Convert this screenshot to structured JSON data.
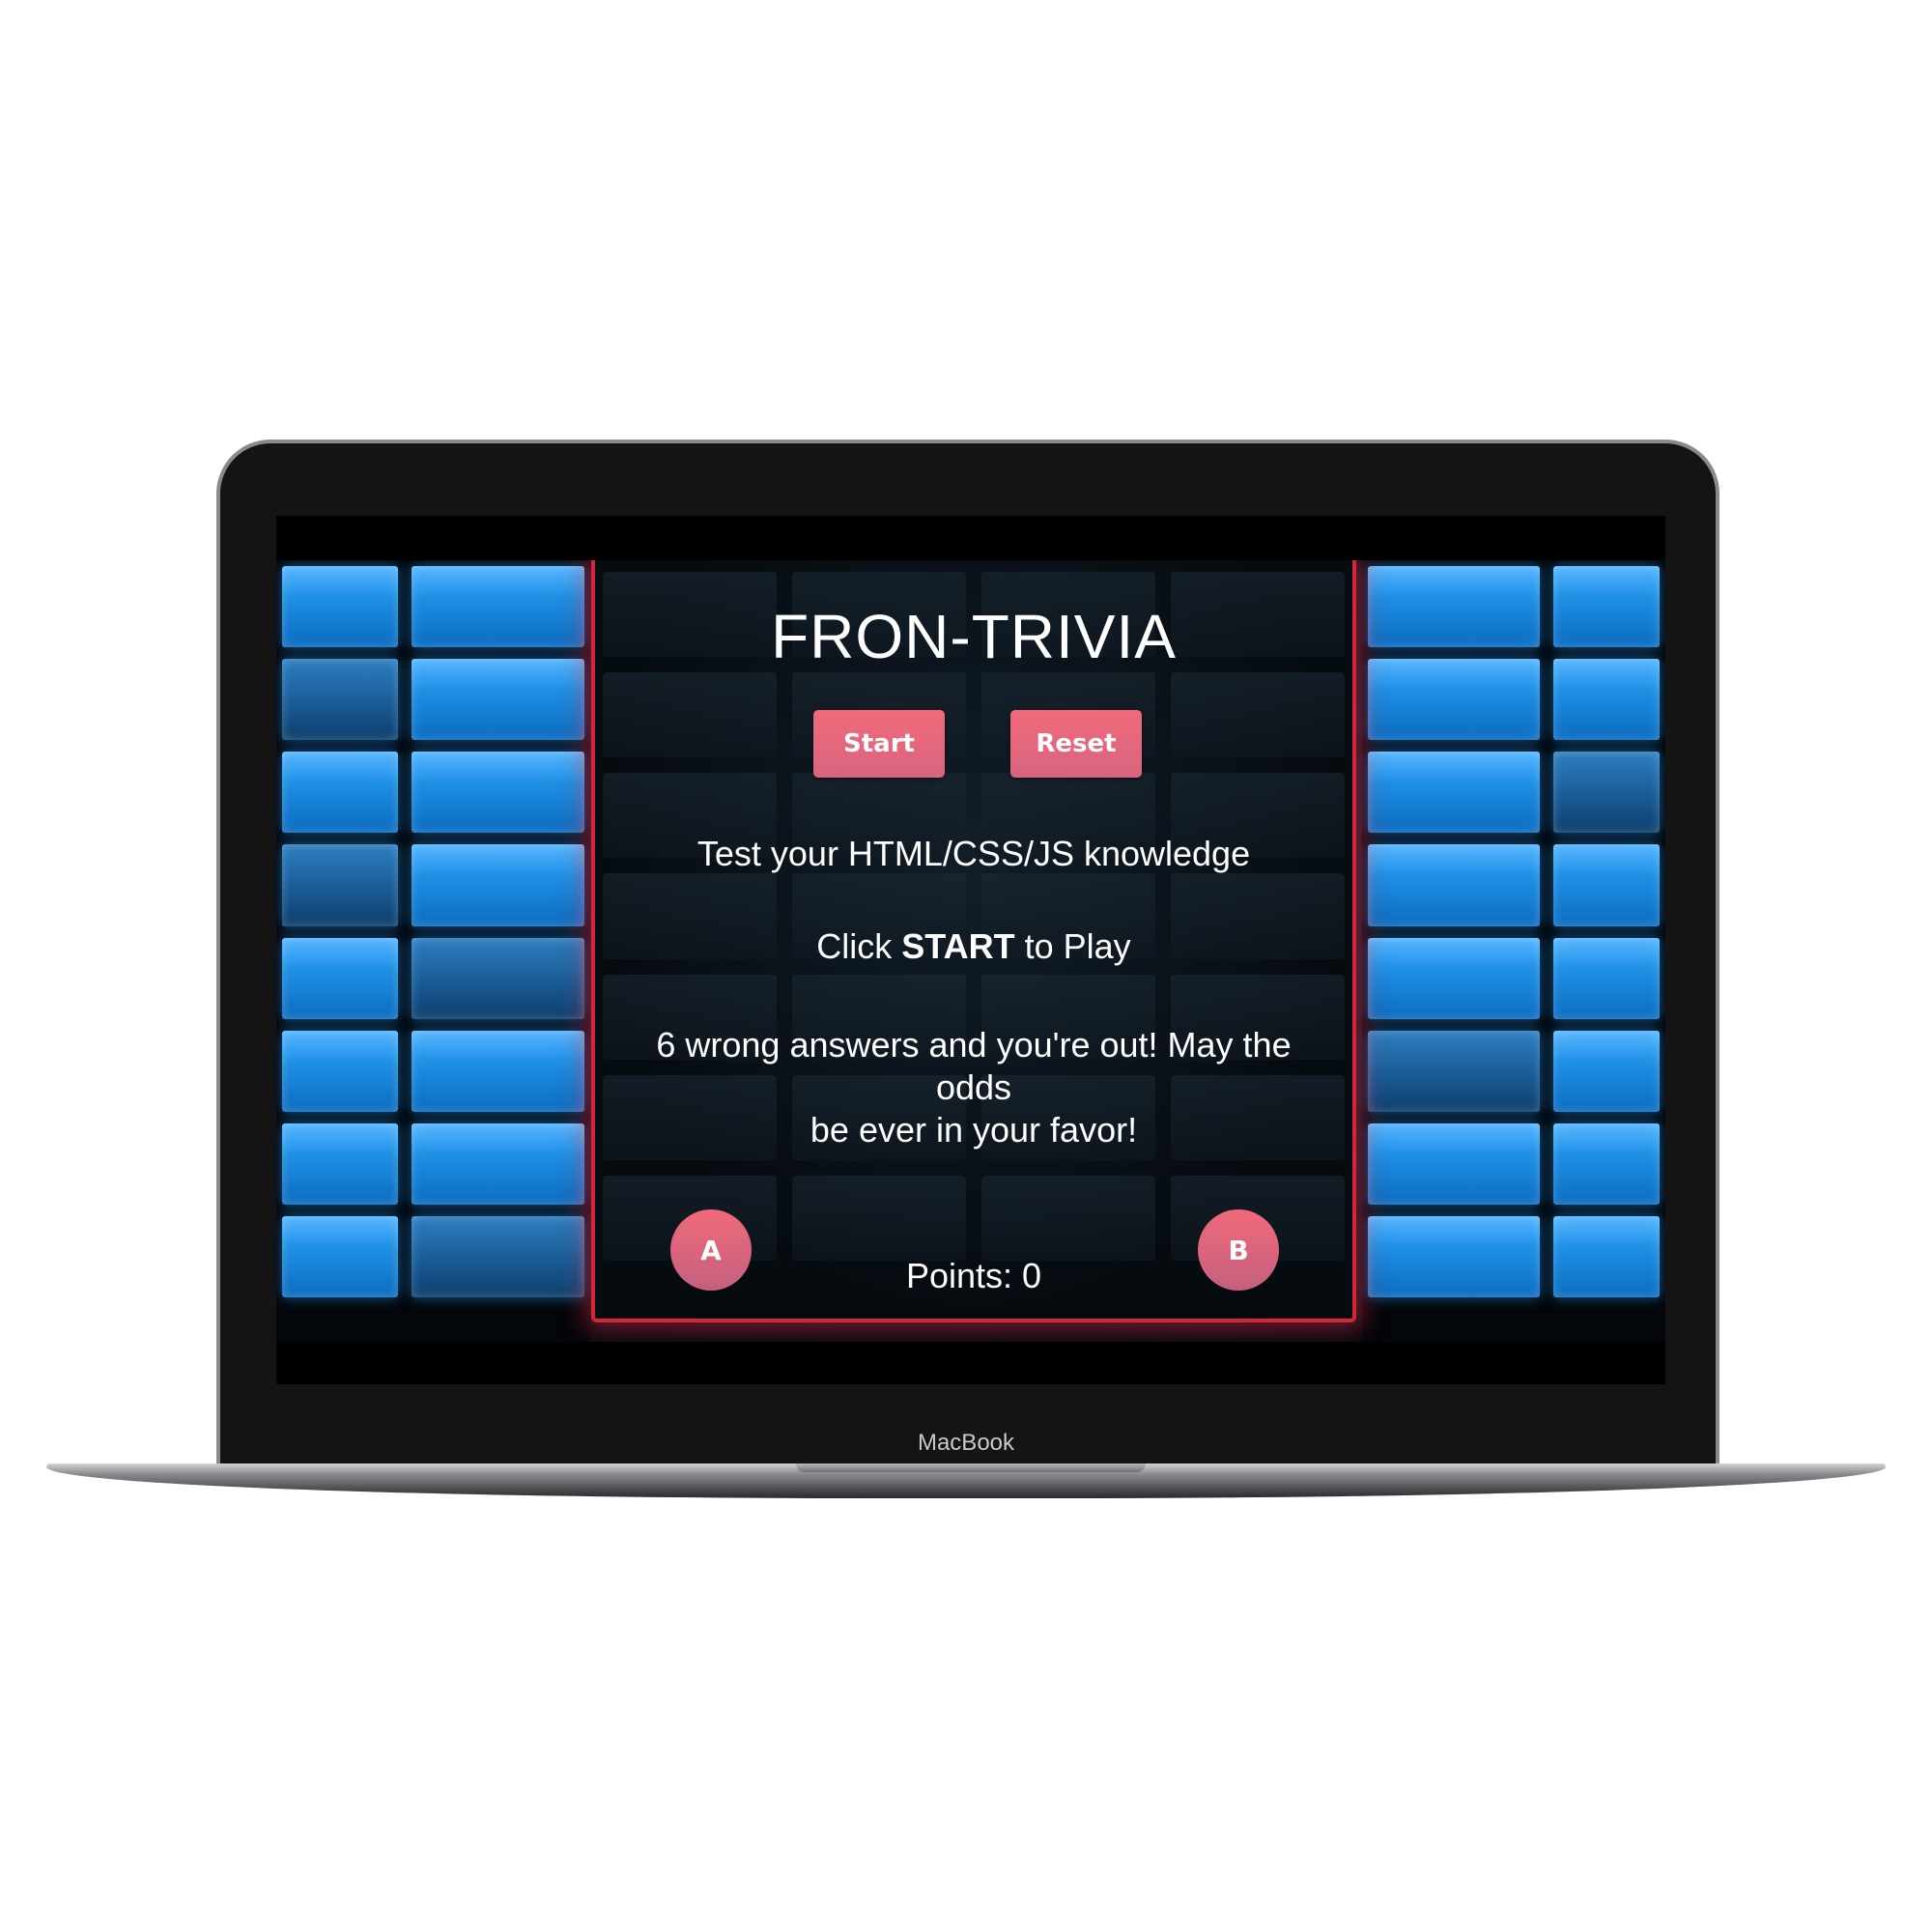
{
  "device": {
    "label": "MacBook"
  },
  "game": {
    "title": "FRON-TRIVIA",
    "start_label": "Start",
    "reset_label": "Reset",
    "tagline": "Test your HTML/CSS/JS knowledge",
    "instruction_prefix": "Click ",
    "instruction_emphasis": "START",
    "instruction_suffix": " to Play",
    "warning_line1": "6 wrong answers and you're out! May the odds",
    "warning_line2": "be ever in your favor!",
    "option_a_label": "A",
    "option_b_label": "B",
    "points_label": "Points: 0"
  },
  "colors": {
    "accent": "#e8697d",
    "panel_border": "#d4253d",
    "tile_blue": "#1d8fe4",
    "text": "#ffffff"
  }
}
